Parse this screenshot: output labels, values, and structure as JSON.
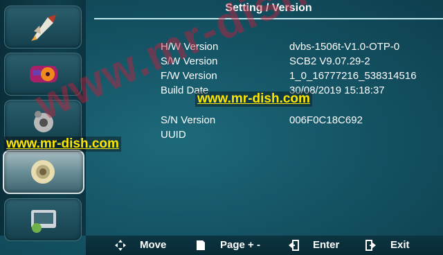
{
  "header": {
    "title": "Setting / Version"
  },
  "info": {
    "rows": [
      {
        "label": "H/W Version",
        "value": "dvbs-1506t-V1.0-OTP-0"
      },
      {
        "label": "S/W Version",
        "value": "SCB2 V9.07.29-2"
      },
      {
        "label": "F/W Version",
        "value": "1_0_16777216_538314516"
      },
      {
        "label": "Build Date",
        "value": "30/08/2019 15:18:37"
      }
    ],
    "sn_label": "S/N Version",
    "sn_value": "006F0C18C692",
    "uuid_label": "UUID",
    "uuid_value": ""
  },
  "watermark": {
    "text_main": "www.mr-dish.com",
    "text_left": "www.mr-dish.com",
    "text_big": "www.mr-dish.com"
  },
  "help_bar": {
    "move": "Move",
    "page": "Page + -",
    "enter": "Enter",
    "exit": "Exit"
  },
  "menu": {
    "items": [
      {
        "icon": "rocket-icon"
      },
      {
        "icon": "media-disc-icon"
      },
      {
        "icon": "settings-gears-icon"
      },
      {
        "icon": "gear-icon"
      },
      {
        "icon": "tools-icon"
      }
    ],
    "selected_index": 3
  },
  "colors": {
    "background": "#155566",
    "watermark_yellow": "#ffe600",
    "watermark_red": "#c81e3c",
    "title_line": "#bfe9ee"
  }
}
